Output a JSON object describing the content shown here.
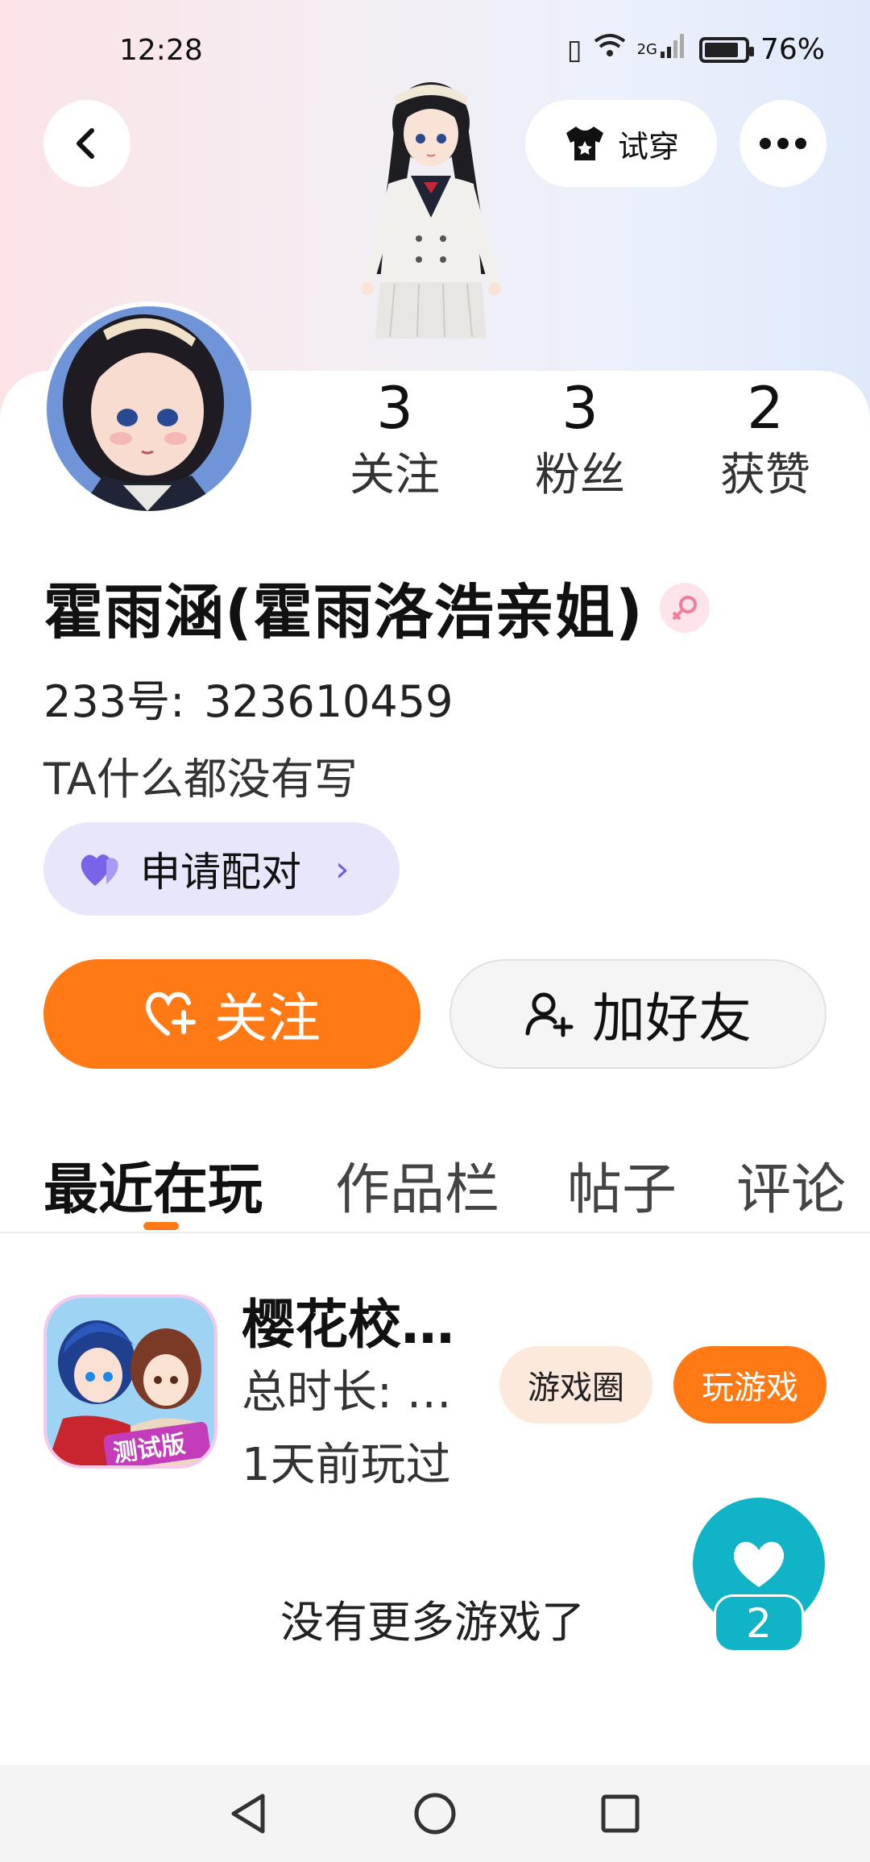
{
  "status_bar": {
    "time": "12:28",
    "network": "2G",
    "battery_text": "76%",
    "battery_level": 0.76
  },
  "header": {
    "tryon_label": "试穿"
  },
  "stats": {
    "following": {
      "value": "3",
      "label": "关注"
    },
    "fans": {
      "value": "3",
      "label": "粉丝"
    },
    "likes": {
      "value": "2",
      "label": "获赞"
    }
  },
  "profile": {
    "name": "霍雨涵(霍雨洛浩亲姐)",
    "id_label": "233号:",
    "id_value": "323610459",
    "bio": "TA什么都没有写"
  },
  "actions": {
    "pair_label": "申请配对",
    "follow_label": "关注",
    "add_friend_label": "加好友"
  },
  "tabs": [
    {
      "label": "最近在玩",
      "active": true
    },
    {
      "label": "作品栏",
      "active": false
    },
    {
      "label": "帖子",
      "active": false
    },
    {
      "label": "评论",
      "active": false
    }
  ],
  "games": [
    {
      "name": "樱花校…",
      "duration": "总时长: …",
      "last_played": "1天前玩过",
      "icon_badge": "测试版",
      "circle_label": "游戏圈",
      "play_label": "玩游戏"
    }
  ],
  "footer": {
    "no_more_text": "没有更多游戏了"
  },
  "like_fab": {
    "count": "2"
  },
  "colors": {
    "accent": "#ff7a14",
    "teal": "#11b3c6",
    "pair_bg": "#e8e6fb",
    "pink": "#fde4ea"
  }
}
